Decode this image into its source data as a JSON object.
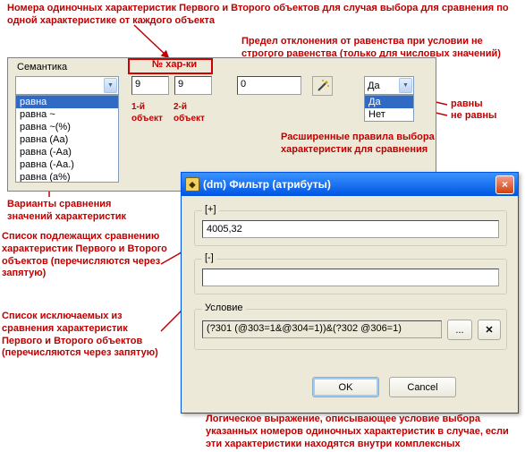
{
  "annotations": {
    "top1": "Номера одиночных характеристик Первого и Второго объектов для случая выбора для сравнения по одной характеристике от каждого объекта",
    "top2": "Предел отклонения от равенства при условии не строгого равенства (только для числовых значений)",
    "char_no": "№ хар-ки",
    "obj1": "1-й\nобъект",
    "obj2": "2-й\nобъект",
    "equal": "равны",
    "notequal": "не равны",
    "right1": "Расширенные правила выбора характеристик для сравнения",
    "left1": "Варианты сравнения значений характеристик",
    "left2": "Список подлежащих сравнению характеристик Первого и Второго объектов (перечисляются через запятую)",
    "left3": "Список исключаемых из сравнения характеристик Первого и Второго объектов (перечисляются через запятую)",
    "bottom1": "Логическое выражение, описывающее условие выбора указанных номеров одиночных характеристик в случае, если эти характеристики находятся внутри комплексных"
  },
  "mainpanel": {
    "label": "Семантика",
    "combo_sel": "",
    "spin1": "9",
    "spin2": "9",
    "num3": "0",
    "combo2_sel": "Да",
    "open_items": [
      "Да",
      "Нет"
    ],
    "list_items": [
      "равна",
      "равна ~",
      "равна ~(%)",
      "равна (Аа)",
      "равна (-Аа)",
      "равна (-Аа.)",
      "равна (а%)"
    ],
    "list_sel_index": 0
  },
  "modal": {
    "title": "(dm) Фильтр (атрибуты)",
    "g1": "[+]",
    "g1val": "4005,32",
    "g2": "[-]",
    "g2val": "",
    "g3": "Условие",
    "g3val": "(?301 (@303=1&@304=1))&(?302 @306=1)",
    "browse": "...",
    "ok": "OK",
    "cancel": "Cancel"
  }
}
